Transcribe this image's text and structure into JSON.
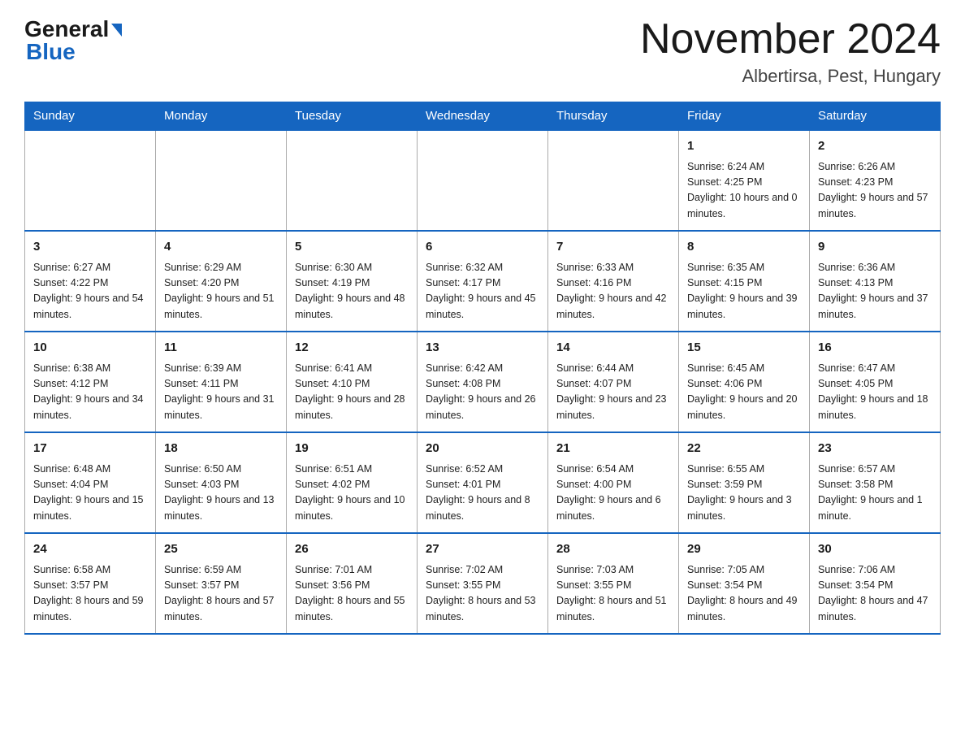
{
  "header": {
    "logo_general": "General",
    "logo_blue": "Blue",
    "month_title": "November 2024",
    "location": "Albertirsa, Pest, Hungary"
  },
  "days_of_week": [
    "Sunday",
    "Monday",
    "Tuesday",
    "Wednesday",
    "Thursday",
    "Friday",
    "Saturday"
  ],
  "weeks": [
    {
      "days": [
        {
          "num": "",
          "info": ""
        },
        {
          "num": "",
          "info": ""
        },
        {
          "num": "",
          "info": ""
        },
        {
          "num": "",
          "info": ""
        },
        {
          "num": "",
          "info": ""
        },
        {
          "num": "1",
          "info": "Sunrise: 6:24 AM\nSunset: 4:25 PM\nDaylight: 10 hours and 0 minutes."
        },
        {
          "num": "2",
          "info": "Sunrise: 6:26 AM\nSunset: 4:23 PM\nDaylight: 9 hours and 57 minutes."
        }
      ]
    },
    {
      "days": [
        {
          "num": "3",
          "info": "Sunrise: 6:27 AM\nSunset: 4:22 PM\nDaylight: 9 hours and 54 minutes."
        },
        {
          "num": "4",
          "info": "Sunrise: 6:29 AM\nSunset: 4:20 PM\nDaylight: 9 hours and 51 minutes."
        },
        {
          "num": "5",
          "info": "Sunrise: 6:30 AM\nSunset: 4:19 PM\nDaylight: 9 hours and 48 minutes."
        },
        {
          "num": "6",
          "info": "Sunrise: 6:32 AM\nSunset: 4:17 PM\nDaylight: 9 hours and 45 minutes."
        },
        {
          "num": "7",
          "info": "Sunrise: 6:33 AM\nSunset: 4:16 PM\nDaylight: 9 hours and 42 minutes."
        },
        {
          "num": "8",
          "info": "Sunrise: 6:35 AM\nSunset: 4:15 PM\nDaylight: 9 hours and 39 minutes."
        },
        {
          "num": "9",
          "info": "Sunrise: 6:36 AM\nSunset: 4:13 PM\nDaylight: 9 hours and 37 minutes."
        }
      ]
    },
    {
      "days": [
        {
          "num": "10",
          "info": "Sunrise: 6:38 AM\nSunset: 4:12 PM\nDaylight: 9 hours and 34 minutes."
        },
        {
          "num": "11",
          "info": "Sunrise: 6:39 AM\nSunset: 4:11 PM\nDaylight: 9 hours and 31 minutes."
        },
        {
          "num": "12",
          "info": "Sunrise: 6:41 AM\nSunset: 4:10 PM\nDaylight: 9 hours and 28 minutes."
        },
        {
          "num": "13",
          "info": "Sunrise: 6:42 AM\nSunset: 4:08 PM\nDaylight: 9 hours and 26 minutes."
        },
        {
          "num": "14",
          "info": "Sunrise: 6:44 AM\nSunset: 4:07 PM\nDaylight: 9 hours and 23 minutes."
        },
        {
          "num": "15",
          "info": "Sunrise: 6:45 AM\nSunset: 4:06 PM\nDaylight: 9 hours and 20 minutes."
        },
        {
          "num": "16",
          "info": "Sunrise: 6:47 AM\nSunset: 4:05 PM\nDaylight: 9 hours and 18 minutes."
        }
      ]
    },
    {
      "days": [
        {
          "num": "17",
          "info": "Sunrise: 6:48 AM\nSunset: 4:04 PM\nDaylight: 9 hours and 15 minutes."
        },
        {
          "num": "18",
          "info": "Sunrise: 6:50 AM\nSunset: 4:03 PM\nDaylight: 9 hours and 13 minutes."
        },
        {
          "num": "19",
          "info": "Sunrise: 6:51 AM\nSunset: 4:02 PM\nDaylight: 9 hours and 10 minutes."
        },
        {
          "num": "20",
          "info": "Sunrise: 6:52 AM\nSunset: 4:01 PM\nDaylight: 9 hours and 8 minutes."
        },
        {
          "num": "21",
          "info": "Sunrise: 6:54 AM\nSunset: 4:00 PM\nDaylight: 9 hours and 6 minutes."
        },
        {
          "num": "22",
          "info": "Sunrise: 6:55 AM\nSunset: 3:59 PM\nDaylight: 9 hours and 3 minutes."
        },
        {
          "num": "23",
          "info": "Sunrise: 6:57 AM\nSunset: 3:58 PM\nDaylight: 9 hours and 1 minute."
        }
      ]
    },
    {
      "days": [
        {
          "num": "24",
          "info": "Sunrise: 6:58 AM\nSunset: 3:57 PM\nDaylight: 8 hours and 59 minutes."
        },
        {
          "num": "25",
          "info": "Sunrise: 6:59 AM\nSunset: 3:57 PM\nDaylight: 8 hours and 57 minutes."
        },
        {
          "num": "26",
          "info": "Sunrise: 7:01 AM\nSunset: 3:56 PM\nDaylight: 8 hours and 55 minutes."
        },
        {
          "num": "27",
          "info": "Sunrise: 7:02 AM\nSunset: 3:55 PM\nDaylight: 8 hours and 53 minutes."
        },
        {
          "num": "28",
          "info": "Sunrise: 7:03 AM\nSunset: 3:55 PM\nDaylight: 8 hours and 51 minutes."
        },
        {
          "num": "29",
          "info": "Sunrise: 7:05 AM\nSunset: 3:54 PM\nDaylight: 8 hours and 49 minutes."
        },
        {
          "num": "30",
          "info": "Sunrise: 7:06 AM\nSunset: 3:54 PM\nDaylight: 8 hours and 47 minutes."
        }
      ]
    }
  ]
}
